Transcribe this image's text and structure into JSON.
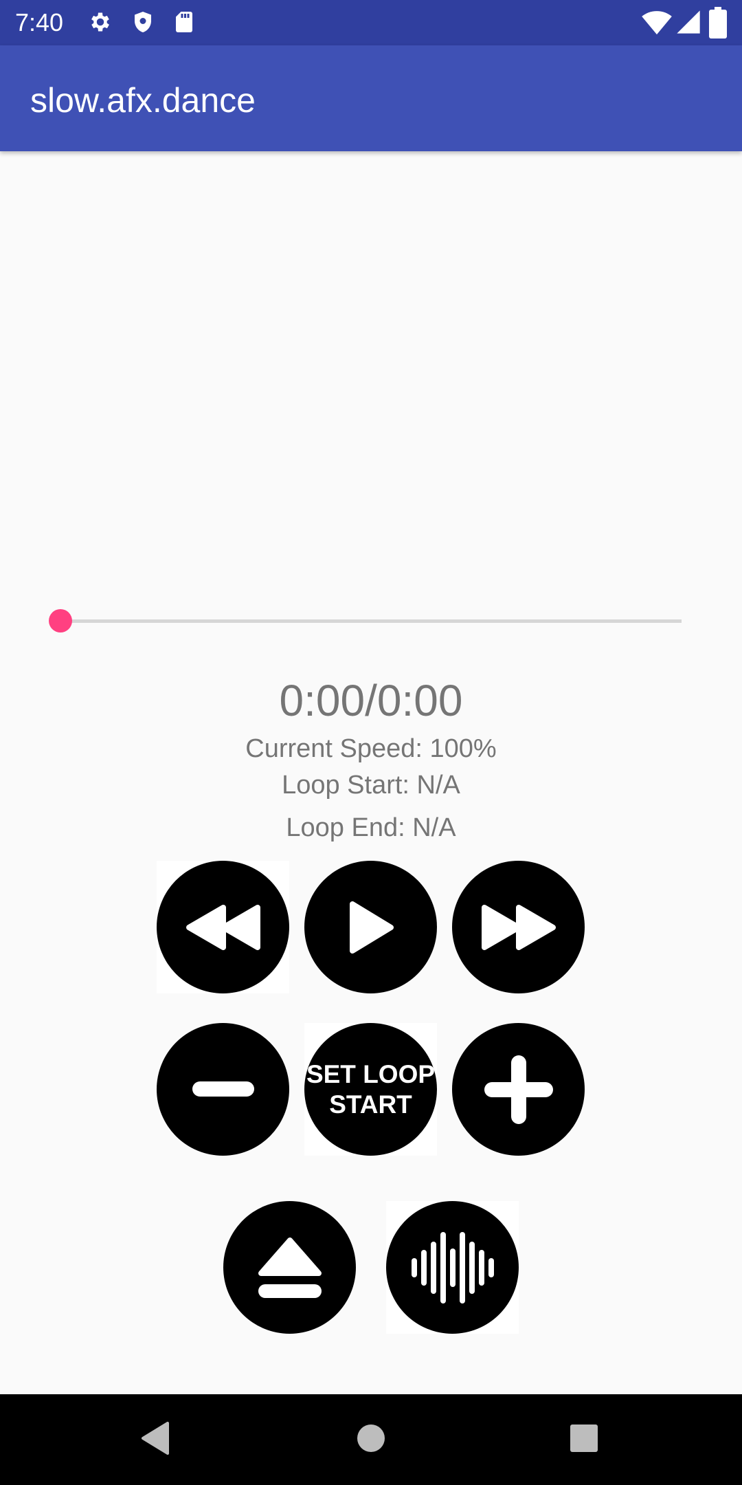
{
  "status_bar": {
    "time": "7:40",
    "icons": [
      "gear-icon",
      "shield-icon",
      "sd-card-icon",
      "wifi-icon",
      "signal-icon",
      "battery-icon"
    ]
  },
  "app_bar": {
    "title": "slow.afx.dance"
  },
  "player": {
    "progress": 0,
    "time_display": "0:00/0:00",
    "current_speed": "Current Speed: 100%",
    "loop_start": "Loop Start: N/A",
    "loop_end": "Loop End: N/A"
  },
  "controls": {
    "row1": [
      "rewind-icon",
      "play-icon",
      "fast-forward-icon"
    ],
    "row2": [
      "minus-icon",
      "SET LOOP\nSTART",
      "plus-icon"
    ],
    "row3": [
      "eject-icon",
      "waveform-icon"
    ],
    "set_loop_label": "SET LOOP\nSTART"
  },
  "colors": {
    "status_bar": "#303f9f",
    "app_bar": "#3f51b5",
    "accent": "#ff4081",
    "text_secondary": "#757575"
  },
  "nav_bar": {
    "buttons": [
      "back-icon",
      "home-icon",
      "recents-icon"
    ]
  }
}
